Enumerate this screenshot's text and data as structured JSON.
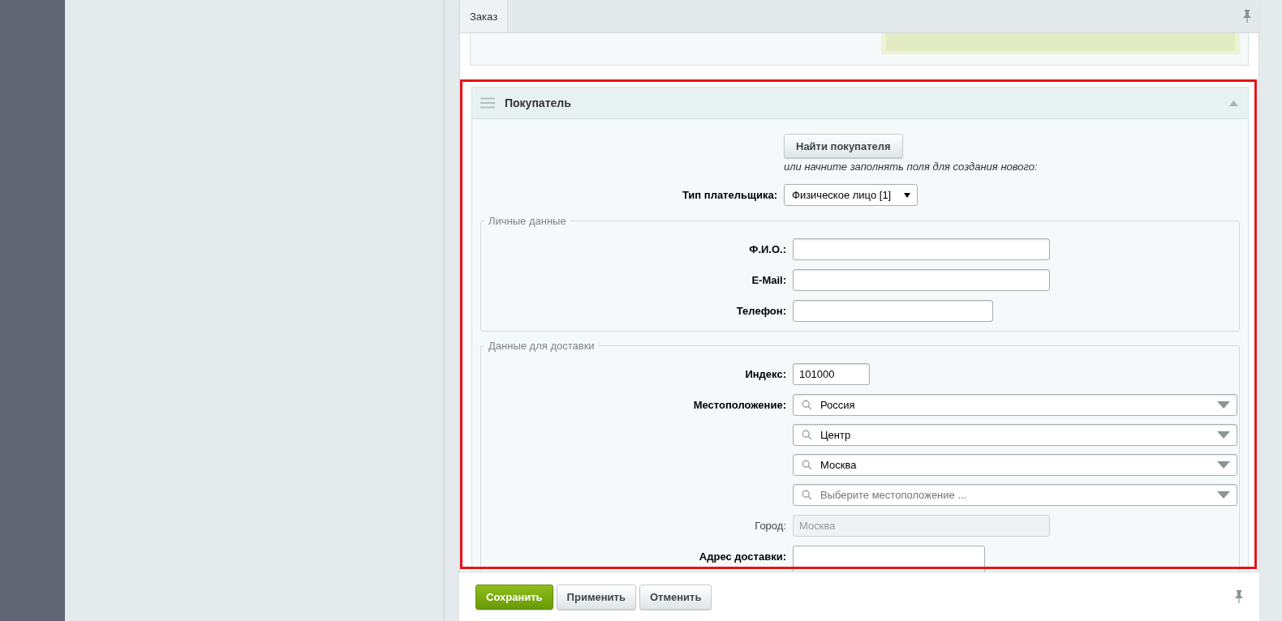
{
  "tabs": [
    {
      "label": "Заказ",
      "selected": true
    }
  ],
  "buyer_section": {
    "title": "Покупатель",
    "expanded": true,
    "find_button": "Найти покупателя",
    "hint": "или начните заполнять поля для создания нового:",
    "payer_type": {
      "label": "Тип плательщика:",
      "value": "Физическое лицо [1]"
    },
    "personal": {
      "legend": "Личные данные",
      "fields": [
        {
          "kind": "text",
          "label": "Ф.И.О.:",
          "required": true
        },
        {
          "kind": "text",
          "label": "E-Mail:",
          "required": true
        },
        {
          "kind": "text",
          "label": "Телефон:",
          "required": true
        }
      ]
    },
    "delivery": {
      "legend": "Данные для доставки",
      "fields": [
        {
          "kind": "text",
          "label": "Индекс:",
          "required": true,
          "value": "101000"
        },
        {
          "kind": "location",
          "label": "Местоположение:",
          "required": true,
          "levels": [
            {
              "value": "Россия"
            },
            {
              "value": "Центр"
            },
            {
              "value": "Москва"
            },
            {
              "placeholder": "Выберите местоположение ..."
            }
          ]
        },
        {
          "kind": "text",
          "label": "Город:",
          "required": false,
          "value": "Москва",
          "disabled": true
        },
        {
          "kind": "textarea",
          "label": "Адрес доставки:",
          "required": true
        }
      ]
    }
  },
  "footer": {
    "buttons": [
      {
        "label": "Сохранить",
        "kind": "primary"
      },
      {
        "label": "Применить",
        "kind": "default"
      },
      {
        "label": "Отменить",
        "kind": "default"
      }
    ]
  }
}
